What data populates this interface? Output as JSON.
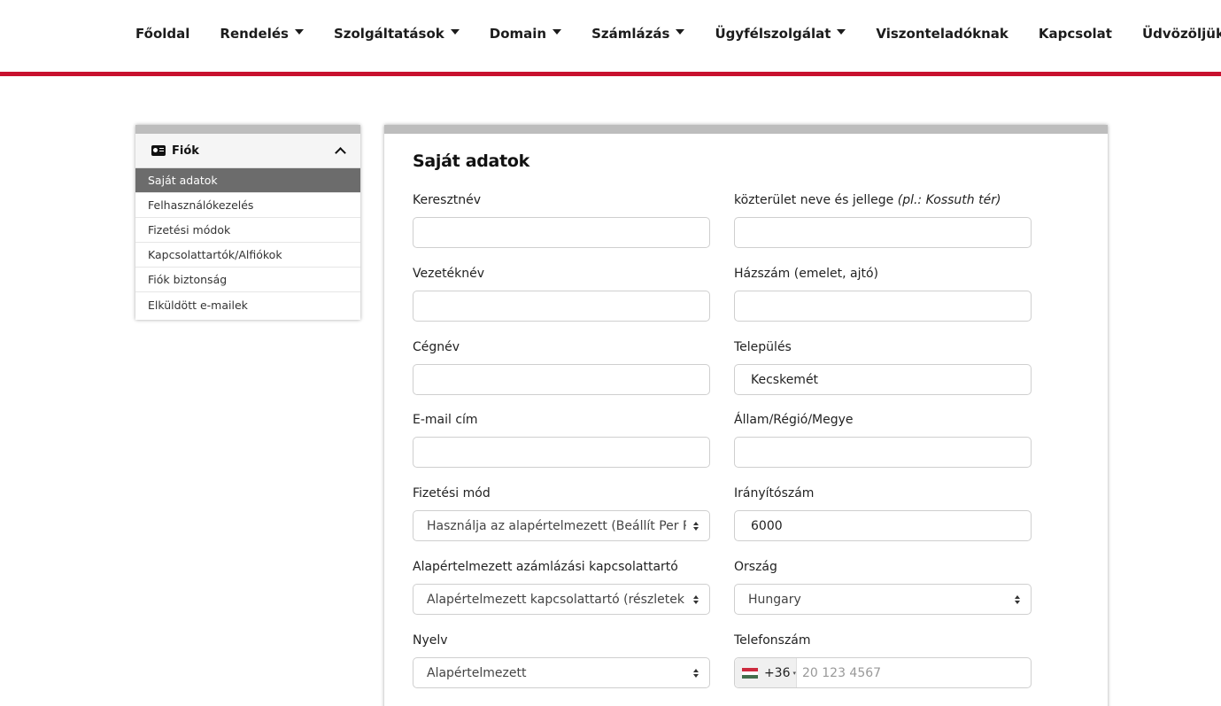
{
  "nav": {
    "items": [
      {
        "label": "Főoldal",
        "dropdown": false
      },
      {
        "label": "Rendelés",
        "dropdown": true
      },
      {
        "label": "Szolgáltatások",
        "dropdown": true
      },
      {
        "label": "Domain",
        "dropdown": true
      },
      {
        "label": "Számlázás",
        "dropdown": true
      },
      {
        "label": "Ügyfélszolgálat",
        "dropdown": true
      },
      {
        "label": "Viszonteladóknak",
        "dropdown": false
      },
      {
        "label": "Kapcsolat",
        "dropdown": false
      },
      {
        "label": "Üdvözöljük !",
        "dropdown": true
      }
    ],
    "accent_color": "#c8102e"
  },
  "sidebar": {
    "title": "Fiók",
    "icon": "id-card-icon",
    "items": [
      {
        "label": "Saját adatok",
        "active": true
      },
      {
        "label": "Felhasználókezelés",
        "active": false
      },
      {
        "label": "Fizetési módok",
        "active": false
      },
      {
        "label": "Kapcsolattartók/Alfiókok",
        "active": false
      },
      {
        "label": "Fiók biztonság",
        "active": false
      },
      {
        "label": "Elküldött e-mailek",
        "active": false
      }
    ]
  },
  "main": {
    "title": "Saját adatok",
    "left": {
      "firstname": {
        "label": "Keresztnév",
        "value": ""
      },
      "lastname": {
        "label": "Vezetéknév",
        "value": ""
      },
      "company": {
        "label": "Cégnév",
        "value": ""
      },
      "email": {
        "label": "E-mail cím",
        "value": ""
      },
      "payment": {
        "label": "Fizetési mód",
        "value": "Használja az alapértelmezett (Beállít Per Rendelés)"
      },
      "billing_contact": {
        "label": "Alapértelmezett azámlázási kapcsolattartó",
        "value": "Alapértelmezett kapcsolattartó (részletek fent)"
      },
      "language": {
        "label": "Nyelv",
        "value": "Alapértelmezett"
      }
    },
    "right": {
      "street": {
        "label": "közterület neve és jellege ",
        "hint": "(pl.: Kossuth tér)",
        "value": ""
      },
      "house": {
        "label": "Házszám (emelet, ajtó)",
        "value": ""
      },
      "city": {
        "label": "Település",
        "value": "Kecskemét"
      },
      "state": {
        "label": "Állam/Régió/Megye",
        "value": ""
      },
      "zip": {
        "label": "Irányítószám",
        "value": "6000"
      },
      "country": {
        "label": "Ország",
        "value": "Hungary"
      },
      "phone": {
        "label": "Telefonszám",
        "code": "+36",
        "placeholder": "20 123 4567"
      }
    }
  }
}
